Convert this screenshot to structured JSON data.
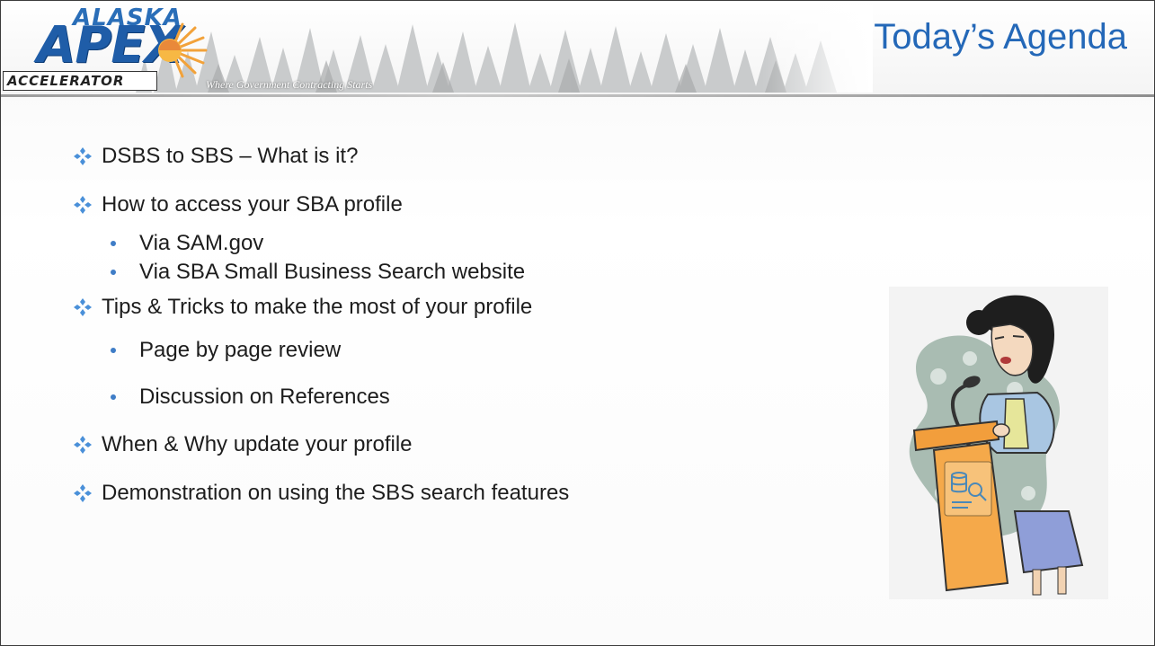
{
  "header": {
    "logo": {
      "line1": "ALASKA",
      "line2": "APEX",
      "line3": "ACCELERATOR"
    },
    "tagline": "Where Government Contracting Starts",
    "title": "Today’s Agenda"
  },
  "agenda": {
    "items": [
      {
        "label": "DSBS to SBS – What is it?"
      },
      {
        "label": "How to access your SBA profile"
      },
      {
        "label": "Tips & Tricks to make the most of your profile"
      },
      {
        "label": "When & Why update your profile"
      },
      {
        "label": "Demonstration on using the SBS search features"
      }
    ],
    "subitems": {
      "access": [
        "Via SAM.gov",
        "Via SBA Small Business Search website"
      ],
      "tips": [
        "Page by page review",
        "Discussion on References"
      ]
    }
  },
  "colors": {
    "title": "#2468b8",
    "bullet_diamond": "#4a90d9",
    "bullet_dot": "#3f7dc7",
    "logo_blue": "#1f5da8",
    "sun_orange": "#f2a23a"
  },
  "icons": {
    "bullet": "four-diamond-bullet-icon",
    "sub_bullet": "dot-bullet-icon",
    "illustration": "speaker-at-podium-illustration"
  }
}
